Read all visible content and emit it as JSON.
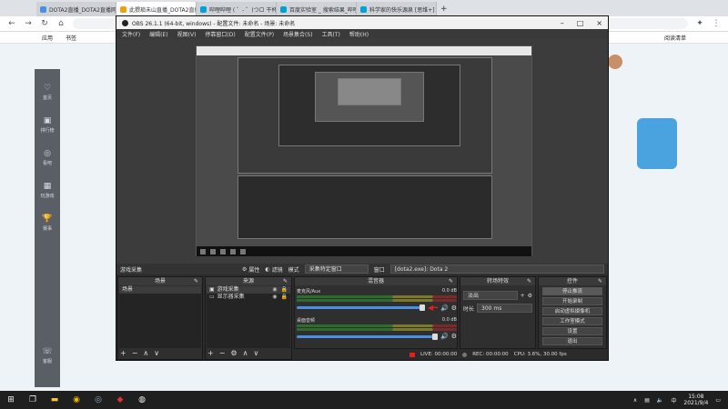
{
  "browser": {
    "tabs": [
      {
        "label": "DOTA2直播_DOTA2直播网站",
        "active": false
      },
      {
        "label": "此猥琐未山直播_DOTA2直播_",
        "active": true
      },
      {
        "label": "哔哩哔哩 ( ゜- ゜)つロ 干杯~-b",
        "active": false
      },
      {
        "label": "百度实验室 _ 搜索结果_哔哩哔",
        "active": false
      },
      {
        "label": "科学家的快乐源泉 [思维+] _ 哔",
        "active": false
      }
    ],
    "new_tab": "+",
    "bookmarks": [
      "应用",
      "书签"
    ],
    "reading_list": "阅读清单"
  },
  "page": {
    "nav_items": [
      {
        "label": "首页",
        "icon": "♡"
      },
      {
        "label": "排行榜",
        "icon": "▣"
      },
      {
        "label": "看吧",
        "icon": "◎"
      },
      {
        "label": "玩游戏",
        "icon": "▦"
      },
      {
        "label": "赛事",
        "icon": "🏆"
      },
      {
        "label": "客服",
        "icon": "☏"
      }
    ]
  },
  "obs": {
    "title": "OBS 26.1.1 (64-bit, windows) - 配置文件: 未命名 - 场景: 未命名",
    "menu": [
      "文件(F)",
      "编辑(E)",
      "视图(V)",
      "停靠窗口(D)",
      "配置文件(P)",
      "场景集合(S)",
      "工具(T)",
      "帮助(H)"
    ],
    "source_toolbar": {
      "current_source": "游戏采集",
      "properties": "属性",
      "filters": "滤镜",
      "mode_label": "模式",
      "mode_value": "采集特定窗口",
      "window_label": "窗口",
      "window_value": "[dota2.exe]: Dota 2"
    },
    "docks": {
      "scenes": {
        "title": "场景",
        "items": [
          "场景"
        ]
      },
      "sources": {
        "title": "来源",
        "items": [
          "游戏采集",
          "显示器采集"
        ]
      },
      "mixer": {
        "title": "混音器",
        "channels": [
          {
            "name": "麦克风/Aux",
            "db": "0.0 dB"
          },
          {
            "name": "桌面音频",
            "db": "0.0 dB"
          }
        ]
      },
      "transitions": {
        "title": "转场特效",
        "type": "淡出",
        "duration_label": "时长",
        "duration_value": "300 ms"
      },
      "controls": {
        "title": "控件",
        "buttons": [
          "停止推流",
          "开始录制",
          "启动虚拟摄像机",
          "工作室模式",
          "设置",
          "退出"
        ]
      }
    },
    "status": {
      "live": "LIVE: 00:00:00",
      "rec": "REC: 00:00:00",
      "cpu": "CPU: 3.6%, 30.00 fps"
    }
  },
  "taskbar": {
    "time": "15:08",
    "date": "2021/9/4",
    "lang": "中"
  },
  "colors": {
    "obs_bg": "#2b2b2b",
    "meter_green": "#2f6b2f",
    "slider_blue": "#4a90e2",
    "arrow_red": "#e02020"
  }
}
